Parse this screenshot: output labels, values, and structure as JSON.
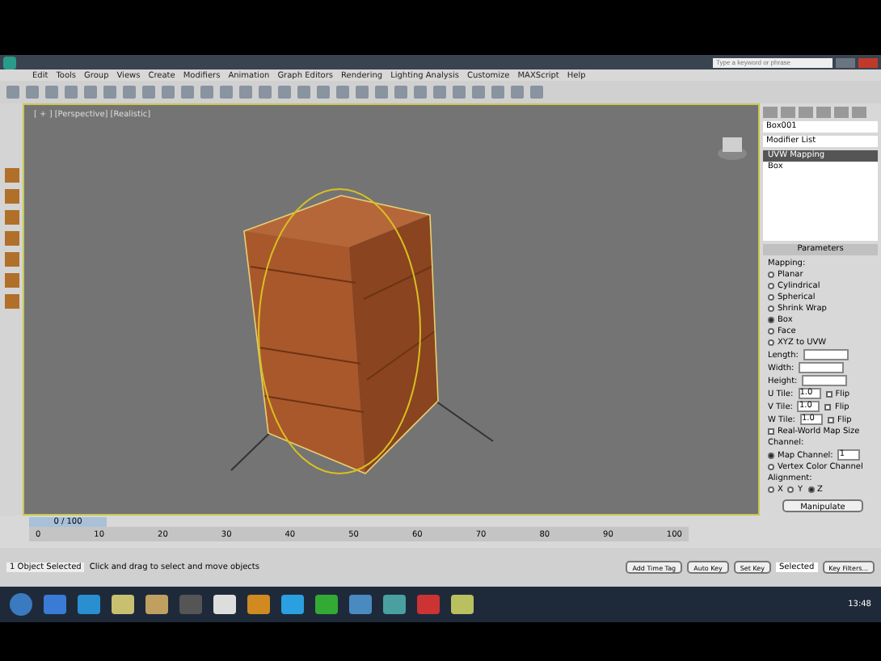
{
  "menu": [
    "Edit",
    "Tools",
    "Group",
    "Views",
    "Create",
    "Modifiers",
    "Animation",
    "Graph Editors",
    "Rendering",
    "Lighting Analysis",
    "Customize",
    "MAXScript",
    "Help"
  ],
  "search": {
    "placeholder": "Type a keyword or phrase"
  },
  "viewport": {
    "label": "[ + ] [Perspective] [Realistic]"
  },
  "panel": {
    "object_name": "Box001",
    "modifier_list": "Modifier List",
    "stack": [
      {
        "label": "UVW Mapping",
        "selected": true
      },
      {
        "label": "Box",
        "selected": false
      }
    ],
    "rollout": "Parameters",
    "mapping_label": "Mapping:",
    "mapping": [
      {
        "label": "Planar",
        "selected": false
      },
      {
        "label": "Cylindrical",
        "selected": false
      },
      {
        "label": "Spherical",
        "selected": false
      },
      {
        "label": "Shrink Wrap",
        "selected": false
      },
      {
        "label": "Box",
        "selected": true
      },
      {
        "label": "Face",
        "selected": false
      },
      {
        "label": "XYZ to UVW",
        "selected": false
      }
    ],
    "dims": [
      "Length:",
      "Width:",
      "Height:"
    ],
    "tiles": [
      {
        "label": "U Tile:",
        "value": "1.0",
        "flip": "Flip",
        "flip_checked": false
      },
      {
        "label": "V Tile:",
        "value": "1.0",
        "flip": "Flip",
        "flip_checked": false
      },
      {
        "label": "W Tile:",
        "value": "1.0",
        "flip": "Flip",
        "flip_checked": false
      }
    ],
    "real_world": {
      "label": "Real-World Map Size",
      "checked": false
    },
    "channel_label": "Channel:",
    "channels": [
      {
        "label": "Map Channel:",
        "value": "1",
        "selected": true
      },
      {
        "label": "Vertex Color Channel",
        "selected": false
      }
    ],
    "alignment_label": "Alignment:",
    "axes": [
      {
        "label": "X",
        "selected": false
      },
      {
        "label": "Y",
        "selected": false
      },
      {
        "label": "Z",
        "selected": true
      }
    ],
    "manipulate": "Manipulate"
  },
  "timeline": {
    "frame": "0 / 100",
    "level": 0,
    "ticks": [
      "0",
      "10",
      "20",
      "30",
      "40",
      "50",
      "60",
      "70",
      "80",
      "90",
      "100"
    ]
  },
  "status": {
    "selection": "1 Object Selected",
    "prompt": "Click and drag to select and move objects",
    "time_tag": "Add Time Tag",
    "auto_key": "Auto Key",
    "set_key": "Set Key",
    "key_mode": "Selected",
    "key_filters": "Key Filters..."
  },
  "clock": "13:48"
}
